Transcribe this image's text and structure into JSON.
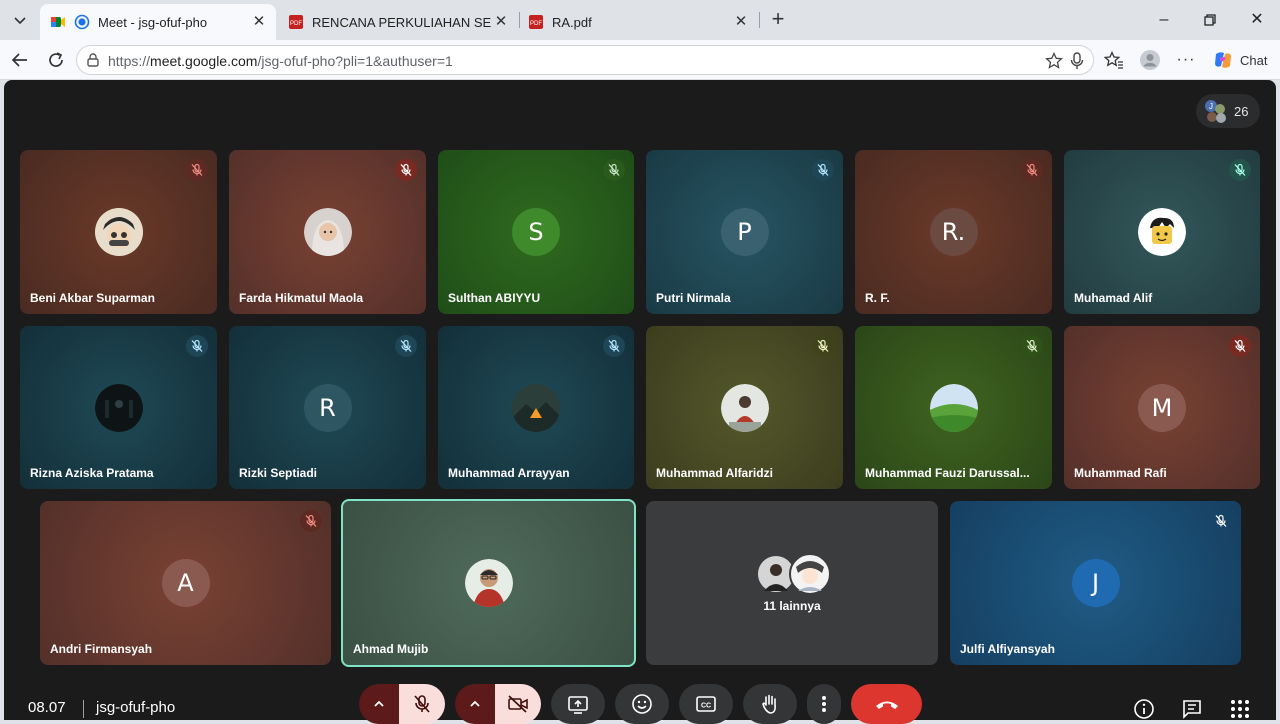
{
  "browser": {
    "tabs": [
      {
        "title": "Meet - jsg-ofuf-pho",
        "active": true
      },
      {
        "title": "RENCANA PERKULIAHAN SEMEST",
        "active": false
      },
      {
        "title": "RA.pdf",
        "active": false
      }
    ],
    "url_prefix": "https://",
    "url_host": "meet.google.com",
    "url_path": "/jsg-ofuf-pho?pli=1&authuser=1",
    "chat_label": "Chat"
  },
  "meeting": {
    "participant_count": "26",
    "time": "08.07",
    "code": "jsg-ofuf-pho",
    "others_label": "11 lainnya"
  },
  "tiles": [
    {
      "name": "Beni Akbar Suparman",
      "initial": "",
      "avatar": "photo"
    },
    {
      "name": "Farda Hikmatul Maola",
      "initial": "",
      "avatar": "photo"
    },
    {
      "name": "Sulthan ABIYYU",
      "initial": "S",
      "avatar": "letter"
    },
    {
      "name": "Putri Nirmala",
      "initial": "P",
      "avatar": "letter"
    },
    {
      "name": "R. F.",
      "initial": "R.",
      "avatar": "letter"
    },
    {
      "name": "Muhamad Alif",
      "initial": "",
      "avatar": "photo"
    },
    {
      "name": "Rizna Aziska Pratama",
      "initial": "",
      "avatar": "photo"
    },
    {
      "name": "Rizki Septiadi",
      "initial": "R",
      "avatar": "letter"
    },
    {
      "name": "Muhammad Arrayyan",
      "initial": "",
      "avatar": "photo"
    },
    {
      "name": "Muhammad Alfaridzi",
      "initial": "",
      "avatar": "photo"
    },
    {
      "name": "Muhammad Fauzi Darussal...",
      "initial": "",
      "avatar": "photo"
    },
    {
      "name": "Muhammad Rafi",
      "initial": "M",
      "avatar": "letter"
    },
    {
      "name": "Andri Firmansyah",
      "initial": "A",
      "avatar": "letter"
    },
    {
      "name": "Ahmad Mujib",
      "initial": "",
      "avatar": "photo"
    },
    {
      "name": "Julfi Alfiyansyah",
      "initial": "J",
      "avatar": "letter"
    }
  ],
  "colors": {
    "accent_border": "#7fe3c7",
    "end_call": "#dc362e",
    "muted_cam": "#f9dedc"
  },
  "icons": [
    "chevron-down-icon",
    "meet-icon",
    "pdf-icon",
    "close-icon",
    "plus-icon",
    "minimize-icon",
    "restore-icon",
    "back-icon",
    "reload-icon",
    "site-info-icon",
    "star-icon",
    "mic-icon",
    "favorites-icon",
    "profile-icon",
    "more-icon",
    "copilot-icon",
    "mic-off-icon",
    "cam-off-icon",
    "present-icon",
    "emoji-icon",
    "captions-icon",
    "raise-hand-icon",
    "end-call-icon",
    "info-icon",
    "chat-icon",
    "activities-icon"
  ]
}
